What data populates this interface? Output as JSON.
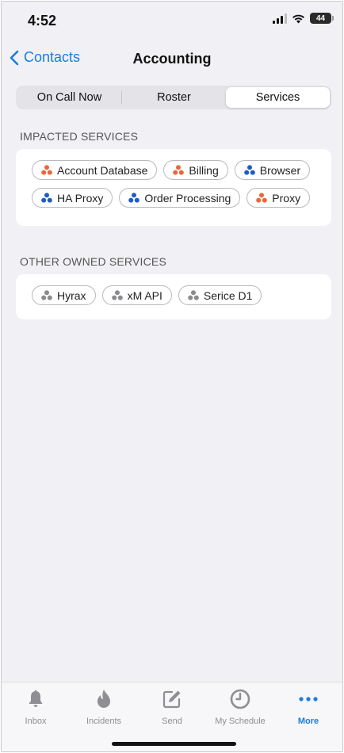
{
  "status": {
    "time": "4:52",
    "battery": "44"
  },
  "nav": {
    "back_label": "Contacts",
    "title": "Accounting"
  },
  "segments": [
    {
      "label": "On Call Now",
      "selected": false
    },
    {
      "label": "Roster",
      "selected": false
    },
    {
      "label": "Services",
      "selected": true
    }
  ],
  "impacted": {
    "label": "IMPACTED SERVICES",
    "services": [
      {
        "name": "Account Database",
        "color": "#e9673b"
      },
      {
        "name": "Billing",
        "color": "#e9673b"
      },
      {
        "name": "Browser",
        "color": "#1f5bc7"
      },
      {
        "name": "HA Proxy",
        "color": "#1f5bc7"
      },
      {
        "name": "Order Processing",
        "color": "#1f5bc7"
      },
      {
        "name": "Proxy",
        "color": "#e9673b"
      }
    ]
  },
  "other_owned": {
    "label": "OTHER OWNED SERVICES",
    "services": [
      {
        "name": "Hyrax",
        "color": "#8a8a8f"
      },
      {
        "name": "xM API",
        "color": "#8a8a8f"
      },
      {
        "name": "Serice D1",
        "color": "#8a8a8f"
      }
    ]
  },
  "tabs": [
    {
      "label": "Inbox",
      "icon": "bell-icon",
      "active": false
    },
    {
      "label": "Incidents",
      "icon": "flame-icon",
      "active": false
    },
    {
      "label": "Send",
      "icon": "compose-icon",
      "active": false
    },
    {
      "label": "My Schedule",
      "icon": "clock-icon",
      "active": false
    },
    {
      "label": "More",
      "icon": "more-dots-icon",
      "active": true
    }
  ],
  "colors": {
    "accent": "#1a7de2",
    "impacted_orange": "#e9673b",
    "impacted_blue": "#1f5bc7",
    "owned_gray": "#8a8a8f"
  }
}
